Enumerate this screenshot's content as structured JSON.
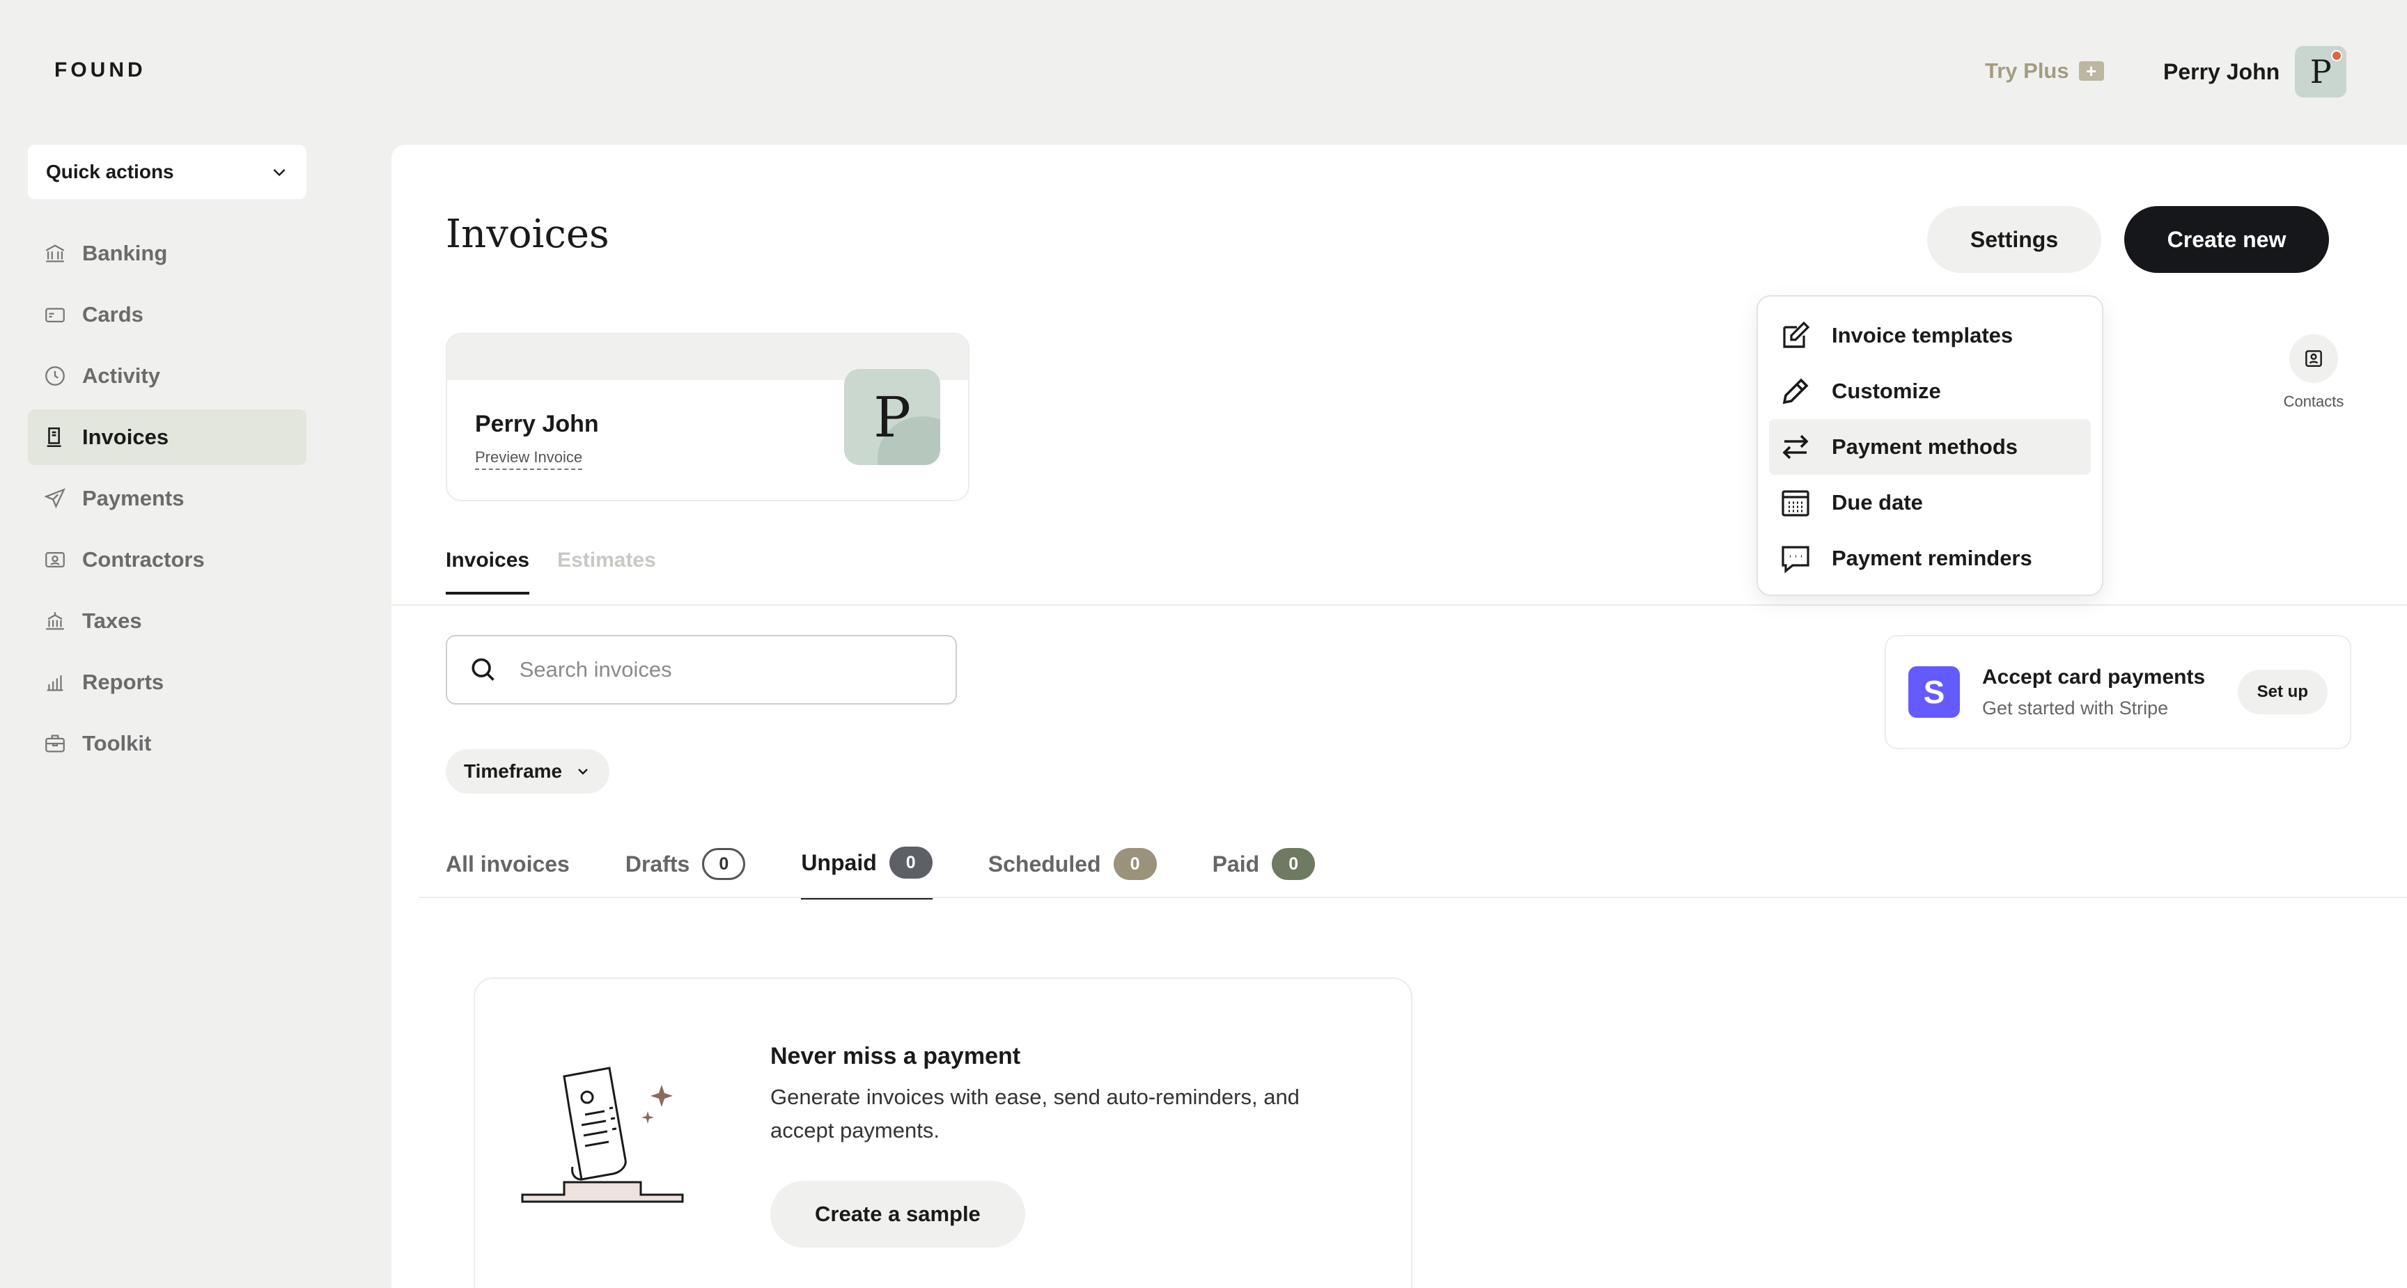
{
  "app": {
    "logo": "FOUND"
  },
  "topbar": {
    "try_plus": "Try Plus",
    "user_name": "Perry John",
    "avatar_letter": "P"
  },
  "sidebar": {
    "quick_actions": "Quick actions",
    "items": [
      {
        "label": "Banking",
        "icon": "bank-icon"
      },
      {
        "label": "Cards",
        "icon": "card-icon"
      },
      {
        "label": "Activity",
        "icon": "clock-icon"
      },
      {
        "label": "Invoices",
        "icon": "invoice-icon",
        "active": true
      },
      {
        "label": "Payments",
        "icon": "send-icon"
      },
      {
        "label": "Contractors",
        "icon": "contractor-icon"
      },
      {
        "label": "Taxes",
        "icon": "government-icon"
      },
      {
        "label": "Reports",
        "icon": "bar-chart-icon"
      },
      {
        "label": "Toolkit",
        "icon": "briefcase-icon"
      }
    ]
  },
  "main": {
    "title": "Invoices",
    "settings_label": "Settings",
    "create_label": "Create new",
    "profile": {
      "name": "Perry John",
      "preview_label": "Preview Invoice",
      "avatar_letter": "P"
    },
    "contacts_label": "Contacts",
    "doc_tabs": [
      {
        "label": "Invoices",
        "active": true
      },
      {
        "label": "Estimates"
      }
    ],
    "search": {
      "placeholder": "Search invoices",
      "value": ""
    },
    "stripe": {
      "title": "Accept card payments",
      "subtitle": "Get started with Stripe",
      "button": "Set up",
      "logo_letter": "S",
      "brand_color": "#635bff"
    },
    "timeframe_label": "Timeframe",
    "status_tabs": [
      {
        "label": "All invoices"
      },
      {
        "label": "Drafts",
        "count": "0"
      },
      {
        "label": "Unpaid",
        "count": "0",
        "active": true
      },
      {
        "label": "Scheduled",
        "count": "0"
      },
      {
        "label": "Paid",
        "count": "0"
      }
    ],
    "promo": {
      "title": "Never miss a payment",
      "description": "Generate invoices with ease, send auto-reminders, and accept payments.",
      "button": "Create a sample"
    }
  },
  "settings_menu": {
    "items": [
      {
        "label": "Invoice templates",
        "icon": "edit-square-icon"
      },
      {
        "label": "Customize",
        "icon": "pencil-icon"
      },
      {
        "label": "Payment methods",
        "icon": "swap-arrows-icon",
        "hover": true
      },
      {
        "label": "Due date",
        "icon": "calendar-icon"
      },
      {
        "label": "Payment reminders",
        "icon": "chat-bubble-icon"
      }
    ]
  }
}
